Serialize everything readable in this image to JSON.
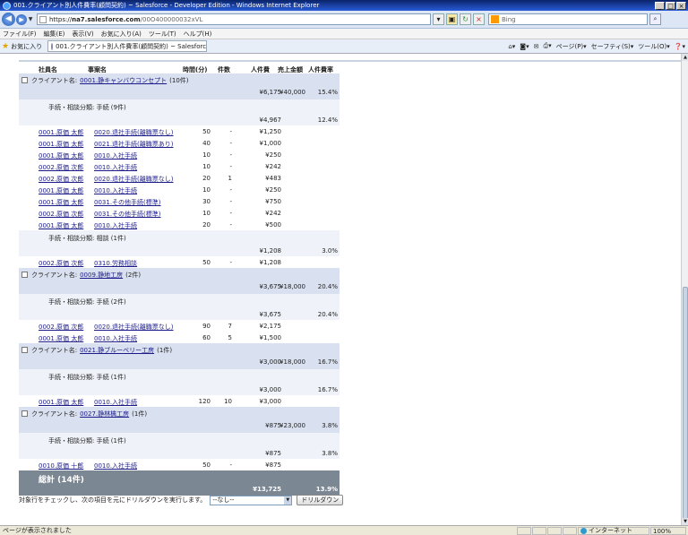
{
  "window": {
    "title": "001.クライアント別人件費率(顧問契約) ~ Salesforce - Developer Edition - Windows Internet Explorer",
    "min": "_",
    "max": "□",
    "close": "×"
  },
  "address": {
    "url_scheme": "https://",
    "url_host": "na7.salesforce.com",
    "url_path": "/00O400000032xVL",
    "search_placeholder": "Bing"
  },
  "menu": [
    "ファイル(F)",
    "編集(E)",
    "表示(V)",
    "お気に入り(A)",
    "ツール(T)",
    "ヘルプ(H)"
  ],
  "favorites": {
    "label": "お気に入り",
    "tab_title": "001.クライアント別人件費率(顧問契約) ~ Salesforce ...",
    "tools": [
      "ページ(P)▾",
      "セーフティ(S)▾",
      "ツール(O)▾"
    ]
  },
  "report": {
    "headers": [
      "社員名",
      "事案名",
      "時間(分)",
      "件数",
      "人件費",
      "売上金額",
      "人件費率"
    ],
    "groups": [
      {
        "client_prefix": "クライアント名:",
        "client_link": "0001.静キャンバウコンセプト",
        "client_count": "(10件)",
        "client_cost": "¥6,175",
        "client_sales": "¥40,000",
        "client_rate": "15.4%",
        "subs": [
          {
            "label": "手続・相談分類: 手続 (9件)",
            "cost": "¥4,967",
            "rate": "12.4%",
            "rows": [
              {
                "employee": "0001.原価 太郎",
                "case": "0020.退社手続(離職票なし)",
                "time": "50",
                "count": "-",
                "cost": "¥1,250"
              },
              {
                "employee": "0001.原価 太郎",
                "case": "0021.退社手続(離職票あり)",
                "time": "40",
                "count": "-",
                "cost": "¥1,000"
              },
              {
                "employee": "0001.原価 太郎",
                "case": "0010.入社手続",
                "time": "10",
                "count": "-",
                "cost": "¥250"
              },
              {
                "employee": "0002.原価 次郎",
                "case": "0010.入社手続",
                "time": "10",
                "count": "-",
                "cost": "¥242"
              },
              {
                "employee": "0002.原価 次郎",
                "case": "0020.退社手続(離職票なし)",
                "time": "20",
                "count": "1",
                "cost": "¥483"
              },
              {
                "employee": "0001.原価 太郎",
                "case": "0010.入社手続",
                "time": "10",
                "count": "-",
                "cost": "¥250"
              },
              {
                "employee": "0001.原価 太郎",
                "case": "0031.その他手続(標準)",
                "time": "30",
                "count": "-",
                "cost": "¥750"
              },
              {
                "employee": "0002.原価 次郎",
                "case": "0031.その他手続(標準)",
                "time": "10",
                "count": "-",
                "cost": "¥242"
              },
              {
                "employee": "0001.原価 太郎",
                "case": "0010.入社手続",
                "time": "20",
                "count": "-",
                "cost": "¥500"
              }
            ]
          },
          {
            "label": "手続・相談分類: 相談 (1件)",
            "cost": "¥1,208",
            "rate": "3.0%",
            "rows": [
              {
                "employee": "0002.原価 次郎",
                "case": "0310.労務相談",
                "time": "50",
                "count": "-",
                "cost": "¥1,208"
              }
            ]
          }
        ]
      },
      {
        "client_prefix": "クライアント名:",
        "client_link": "0009.静地工房",
        "client_count": "(2件)",
        "client_cost": "¥3,675",
        "client_sales": "¥18,000",
        "client_rate": "20.4%",
        "subs": [
          {
            "label": "手続・相談分類: 手続 (2件)",
            "cost": "¥3,675",
            "rate": "20.4%",
            "rows": [
              {
                "employee": "0002.原価 次郎",
                "case": "0020.退社手続(離職票なし)",
                "time": "90",
                "count": "7",
                "cost": "¥2,175"
              },
              {
                "employee": "0001.原価 太郎",
                "case": "0010.入社手続",
                "time": "60",
                "count": "5",
                "cost": "¥1,500"
              }
            ]
          }
        ]
      },
      {
        "client_prefix": "クライアント名:",
        "client_link": "0021.静ブルーベリー工房",
        "client_count": "(1件)",
        "client_cost": "¥3,000",
        "client_sales": "¥18,000",
        "client_rate": "16.7%",
        "subs": [
          {
            "label": "手続・相談分類: 手続 (1件)",
            "cost": "¥3,000",
            "rate": "16.7%",
            "rows": [
              {
                "employee": "0001.原価 太郎",
                "case": "0010.入社手続",
                "time": "120",
                "count": "10",
                "cost": "¥3,000"
              }
            ]
          }
        ]
      },
      {
        "client_prefix": "クライアント名:",
        "client_link": "0027.静林檎工房",
        "client_count": "(1件)",
        "client_cost": "¥875",
        "client_sales": "¥23,000",
        "client_rate": "3.8%",
        "subs": [
          {
            "label": "手続・相談分類: 手続 (1件)",
            "cost": "¥875",
            "rate": "3.8%",
            "rows": [
              {
                "employee": "0010.原価 十郎",
                "case": "0010.入社手続",
                "time": "50",
                "count": "-",
                "cost": "¥875"
              }
            ]
          }
        ]
      }
    ],
    "total_label": "総計 (14件)",
    "total_cost": "¥13,725",
    "total_rate": "13.9%"
  },
  "drilldown": {
    "instruction": "対象行をチェックし、次の項目を元にドリルダウンを実行します。",
    "select_value": "--なし--",
    "button": "ドリルダウン"
  },
  "status": {
    "text": "ページが表示されました",
    "zone": "インターネット",
    "zoom": "100%"
  }
}
